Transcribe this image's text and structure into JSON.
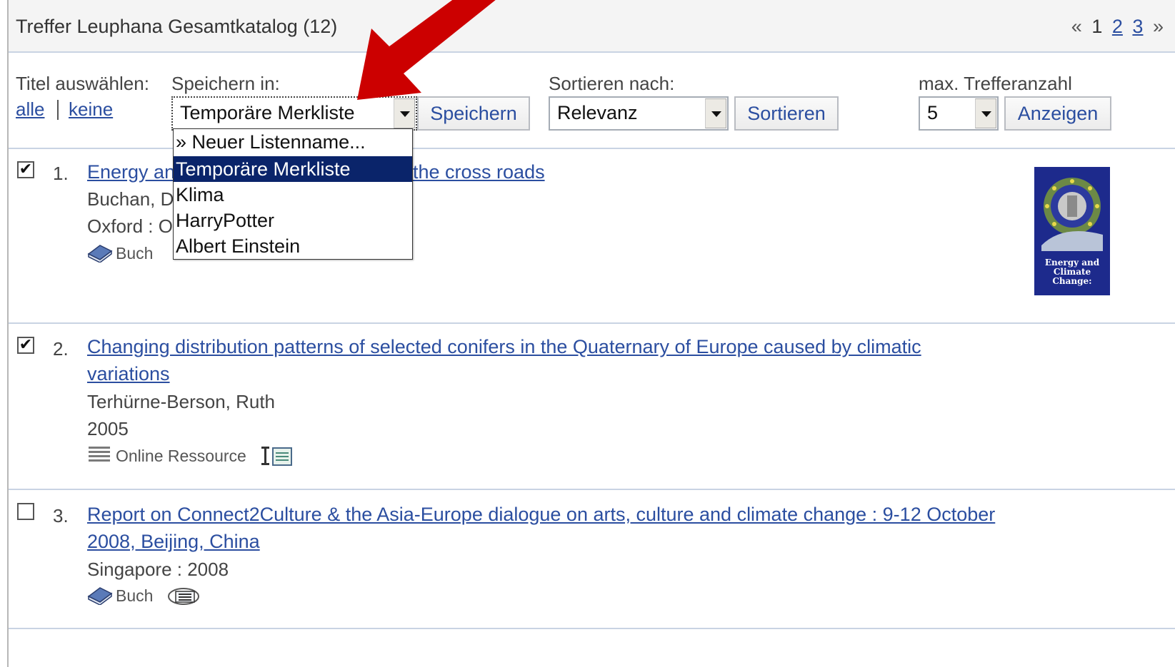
{
  "header": {
    "title": "Treffer Leuphana Gesamtkatalog (12)",
    "pager": {
      "prev": "«",
      "current": "1",
      "pages": [
        "2",
        "3"
      ],
      "next": "»"
    }
  },
  "controls": {
    "select_titles_label": "Titel auswählen:",
    "select_all": "alle",
    "select_none": "keine",
    "save_in_label": "Speichern in:",
    "save_in_value": "Temporäre Merkliste",
    "save_button": "Speichern",
    "sort_label": "Sortieren nach:",
    "sort_value": "Relevanz",
    "sort_button": "Sortieren",
    "max_label": "max. Trefferanzahl",
    "max_value": "5",
    "show_button": "Anzeigen"
  },
  "dropdown": {
    "options": [
      "» Neuer Listenname...",
      "Temporäre Merkliste",
      "Klima",
      "HarryPotter",
      "Albert Einstein"
    ],
    "selected_index": 1
  },
  "results": [
    {
      "number": "1.",
      "checked": true,
      "title_visible_start": "Energy an",
      "title_visible_end": "the cross roads",
      "author_visible": "Buchan, D",
      "publisher_visible": "Oxford :  O",
      "type": "Buch",
      "cover_text": "Energy and Climate Change:"
    },
    {
      "number": "2.",
      "checked": true,
      "title_line1": "Changing distribution patterns of selected conifers in the Quaternary of Europe caused by climatic",
      "title_line2": "variations",
      "author": "Terhürne-Berson, Ruth",
      "year": "2005",
      "type": "Online Ressource"
    },
    {
      "number": "3.",
      "checked": false,
      "title_line1": "Report on Connect2Culture & the Asia-Europe dialogue on arts, culture and climate change : 9-12 October",
      "title_line2": "2008, Beijing, China",
      "publisher": "Singapore :  2008",
      "type": "Buch"
    }
  ],
  "colors": {
    "link": "#2b4ea0",
    "arrow": "#cc0000",
    "selected_bg": "#0a246a"
  }
}
